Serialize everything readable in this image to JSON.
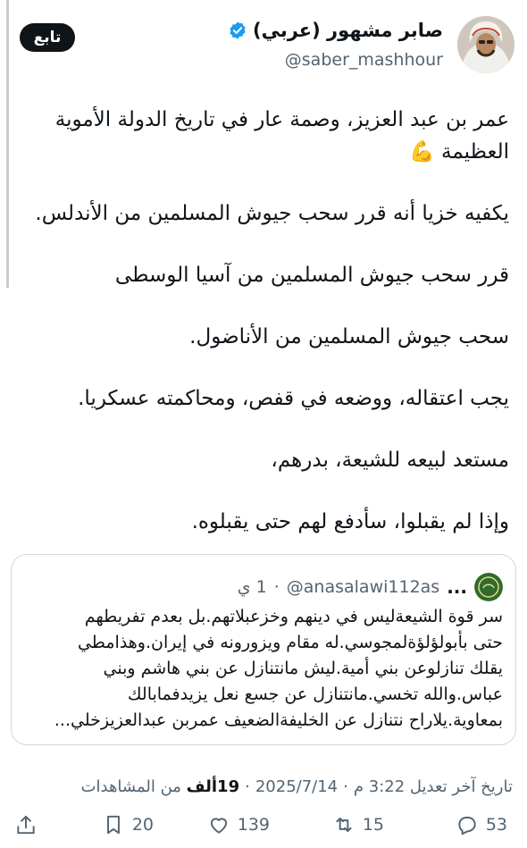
{
  "author": {
    "display_name": "صابر مشهور (عربي)",
    "handle": "@saber_mashhour",
    "follow_label": "تابع"
  },
  "tweet": {
    "paragraphs": [
      [
        "عمر بن عبد العزيز، وصمة عار في تاريخ الدولة الأموية",
        "العظيمة 💪"
      ],
      [
        "يكفيه خزيا أنه قرر سحب جيوش المسلمين من الأندلس."
      ],
      [
        "قرر سحب جيوش المسلمين من آسيا الوسطى"
      ],
      [
        "سحب جيوش المسلمين من الأناضول."
      ],
      [
        "يجب اعتقاله، ووضعه في قفص، ومحاكمته عسكريا."
      ],
      [
        "مستعد لبيعه للشيعة، بدرهم،"
      ],
      [
        "وإذا لم يقبلوا، سأدفع لهم حتى يقبلوه."
      ]
    ]
  },
  "quote": {
    "time": "1 ي",
    "handle": "@anasalawi112as",
    "name_ellipsis": "...",
    "lines": [
      "سر قوة الشيعةليس في دينهم وخزعبلاتهم.بل بعدم تفريطهم",
      "حتى بأبولؤلؤةلمجوسي.له مقام ويزورونه في إيران.وهذامطي",
      "يقلك تنازلوعن بني أمية.ليش مانتنازل عن بني هاشم وبني",
      "عباس.والله تخسي.مانتنازل عن جسع نعل يزيدفمابالك",
      "بمعاوية.يلاراح نتنازل عن الخليفةالضعيف عمربن عبدالعزيزخلي..."
    ]
  },
  "meta": {
    "edited": "تاريخ آخر تعديل 3:22 م",
    "sep": "·",
    "date": "2025/7/14",
    "views_count": "19ألف",
    "views_label": "من المشاهدات"
  },
  "actions": {
    "replies": "53",
    "retweets": "15",
    "likes": "139",
    "bookmarks": "20"
  },
  "colors": {
    "verified": "#1d9bf0",
    "text_secondary": "#536471",
    "text_primary": "#0f1419"
  }
}
